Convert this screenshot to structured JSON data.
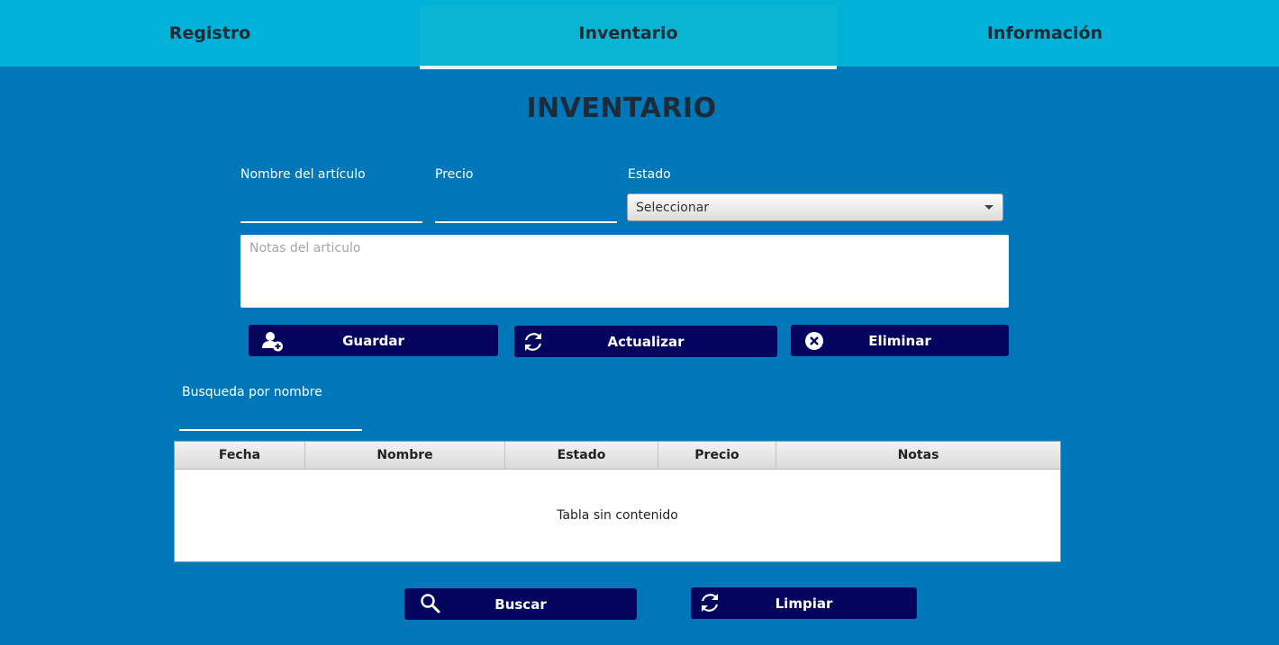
{
  "tabs": [
    {
      "label": "Registro"
    },
    {
      "label": "Inventario"
    },
    {
      "label": "Información"
    }
  ],
  "page_title": "INVENTARIO",
  "form": {
    "name_label": "Nombre del artículo",
    "name_value": "",
    "price_label": "Precio",
    "price_value": "",
    "state_label": "Estado",
    "state_selected": "Seleccionar",
    "notes_placeholder": "Notas del articulo"
  },
  "actions": {
    "save": {
      "label": "Guardar",
      "icon": "add-user-icon"
    },
    "update": {
      "label": "Actualizar",
      "icon": "refresh-icon"
    },
    "delete": {
      "label": "Eliminar",
      "icon": "close-circle-icon"
    }
  },
  "search": {
    "label": "Busqueda por nombre",
    "value": ""
  },
  "table": {
    "columns": [
      "Fecha",
      "Nombre",
      "Estado",
      "Precio",
      "Notas"
    ],
    "rows": [],
    "empty_text": "Tabla sin contenido"
  },
  "bottom_actions": {
    "search": {
      "label": "Buscar",
      "icon": "search-icon"
    },
    "clear": {
      "label": "Limpiar",
      "icon": "refresh-icon"
    }
  },
  "colors": {
    "background": "#0077b8",
    "tabbar": "#00b2d8",
    "button": "#03045e"
  }
}
